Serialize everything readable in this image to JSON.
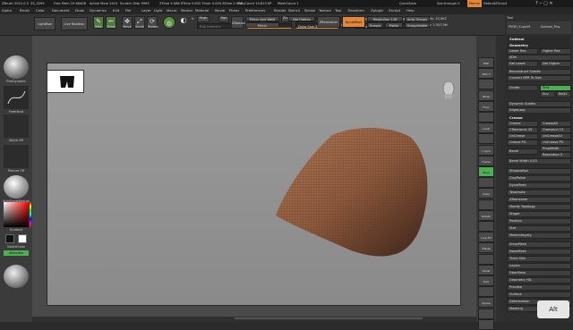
{
  "titlebar": {
    "segments": [
      "ZBrush 2022.0.5",
      "ZS_3295",
      "Free Mem 19.66408",
      "Active Mem 2410",
      "Scratch Disk 9965",
      "ZTime 5.086 RTime 0.632 Timer 0.004 ATime 0.008",
      "PolyCount 10.819 KP",
      "MeshCount 1"
    ],
    "quicksave": "QuickSave",
    "see_through": "See-through 0",
    "menus_label": "Menus",
    "script": "DefaultZScript"
  },
  "menubar": {
    "items": [
      "Alpha",
      "Brush",
      "Color",
      "Document",
      "Draw",
      "Dynamics",
      "Edit",
      "File",
      "Layer",
      "Light",
      "Macro",
      "Marker",
      "Material",
      "Movie",
      "Picker",
      "Preferences",
      "Render",
      "Stencil",
      "Stroke",
      "Texture",
      "Tool",
      "Transform",
      "Zplugin",
      "Zscript",
      "Help"
    ]
  },
  "toolshelf": {
    "lightbox": "LightBox",
    "live_boolean": "Live Boolean",
    "edit": "Edit",
    "draw": "Draw",
    "move": "Move",
    "scale": "Scale",
    "rotate": "Rotate",
    "a_label": "A",
    "mrgb": "Mrgb",
    "rgb": "Rgb",
    "m": "M",
    "zadd": "Zadd",
    "zsub": "Zsub",
    "zcut": "Zcut",
    "rgb_intensity": "Rgb Intensity",
    "z_intensity": "Z Intensity 43",
    "focal_shift": "Focal Shift -43",
    "draw_size": "Draw Size 34.78934",
    "dynamic": "Dynamic",
    "zremesher_mini": "ZRemesher",
    "mirror_and_weld": "Mirror And Weld",
    "del_hidden": "Del Hidden",
    "mirror": "Mirror",
    "zremesher": "ZRemesher",
    "dynamesh": "DynaMesh",
    "resolution": "Resolution 128",
    "groups": "Groups",
    "polish": "Polish",
    "auto_groups": "Auto Groups",
    "group_visible": "GroupVisible",
    "replay_last": "ReplayLast",
    "replay_last_rel": "ReplayLastRel",
    "active_points": "ActivePoints: 10,962",
    "total_points": "TotalPoints: 2.923 Mil",
    "adjust_last": "AdjustLast 1"
  },
  "leftshelf": {
    "brush": "TrimDynamic",
    "stroke": "FreeHand",
    "alpha": "Alpha Off",
    "texture": "Texture Off",
    "material": "SkinShadeMatcap",
    "gradient": "Gradient",
    "switch_color": "SwitchColor",
    "alternate": "Alternate"
  },
  "rightshelf": {
    "items": [
      "BPR",
      "SPix 3",
      "",
      "Persp",
      "Floor",
      "",
      "Local",
      "",
      "L.Sym",
      "Frame",
      "Move",
      "",
      "Scale",
      "",
      "Rotate",
      "",
      "Line Fill PolyF",
      "Transp",
      "",
      "Ghost",
      "Solo",
      "",
      "Xpose",
      "",
      ""
    ]
  },
  "palette": {
    "top_label": "Tool",
    "header_items": [
      "PM3D_SuperM",
      "Subtool_Poly"
    ],
    "subtool": "Subtool",
    "geometry": "Geometry",
    "lower_res": "Lower Res",
    "higher_res": "Higher Res",
    "sdiv": "SDiv",
    "del_lower": "Del Lower",
    "del_higher": "Del Higher",
    "reconstruct_subdiv": "Reconstruct Subdiv",
    "convert_bpr": "Convert BPR To Geo",
    "divide": "Divide",
    "smt": "Smt",
    "suv": "Suv",
    "reuv": "ReUV",
    "dynamic_subdiv": "Dynamic Subdiv",
    "edgeloop": "EdgeLoop",
    "crease_head": "Crease",
    "crease": "Crease",
    "crease_all": "CreaseAll",
    "ctolerance": "CTolerance 45",
    "crease_lvl": "CreaseLvl 15",
    "uncrease": "UnCrease",
    "uncrease_all": "UnCreaseAll",
    "crease_pg": "Crease PG",
    "uncrease_pg": "UnCrease PG",
    "bevel": "Bevel",
    "props_width": "PropWidth",
    "resolution": "Resolution 0",
    "bevel_width": "Bevel Width 0.03",
    "shadowbox": "ShadowBox",
    "claypolish": "ClayPolish",
    "dynamesh": "DynaMesh",
    "tessimate": "Tessimate",
    "zremesher": "ZRemesher",
    "modify_topology": "Modify Topology",
    "stager": "Stager",
    "position": "Position",
    "size": "Size",
    "meshintegrity": "MeshIntegrity",
    "arraymesh": "ArrayMesh",
    "nanomesh": "NanoMesh",
    "thick_skin": "Thick Skin",
    "layers": "Layers",
    "fibermesh": "FiberMesh",
    "geometry_hd": "Geometry HD",
    "preview": "Preview",
    "surface": "Surface",
    "deformation": "Deformation",
    "masking": "Masking"
  },
  "colors": {
    "accent": "#e0873a",
    "selected_green": "#4caf50",
    "mesh_base": "#8e5a3c"
  },
  "watermark": "Alt"
}
